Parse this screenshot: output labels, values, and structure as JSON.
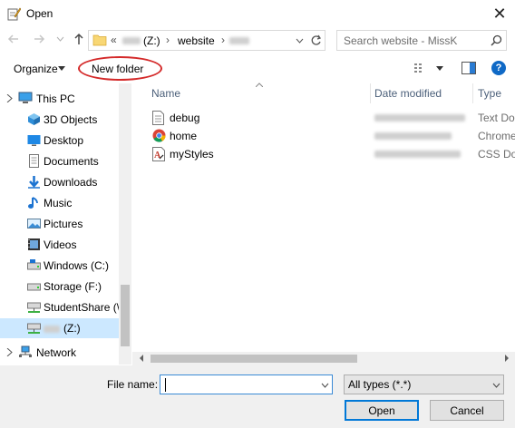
{
  "window": {
    "title": "Open",
    "close_glyph": "✕"
  },
  "nav": {
    "back_icon": "left-arrow-icon",
    "forward_icon": "right-arrow-icon",
    "up_icon": "up-arrow-icon",
    "address_prefix": "«",
    "drive_label": "(Z:)",
    "separator": "›",
    "current_folder": "website",
    "after_folder": "›",
    "search_placeholder": "Search website - MissK"
  },
  "toolbar": {
    "organize_label": "Organize",
    "new_folder_label": "New folder",
    "help_glyph": "?"
  },
  "sidebar": {
    "items": [
      {
        "label": "This PC",
        "icon": "pc-icon"
      },
      {
        "label": "3D Objects",
        "icon": "cube-icon"
      },
      {
        "label": "Desktop",
        "icon": "desktop-icon"
      },
      {
        "label": "Documents",
        "icon": "documents-icon"
      },
      {
        "label": "Downloads",
        "icon": "download-icon"
      },
      {
        "label": "Music",
        "icon": "music-icon"
      },
      {
        "label": "Pictures",
        "icon": "pictures-icon"
      },
      {
        "label": "Videos",
        "icon": "videos-icon"
      },
      {
        "label": "Windows (C:)",
        "icon": "drive-icon"
      },
      {
        "label": "Storage (F:)",
        "icon": "drive-icon"
      },
      {
        "label": "StudentShare (\\\\",
        "icon": "network-drive-icon"
      },
      {
        "label": "(Z:)",
        "icon": "network-drive-icon"
      },
      {
        "label": "Network",
        "icon": "network-icon"
      }
    ]
  },
  "columns": {
    "name": "Name",
    "date": "Date modified",
    "type": "Type"
  },
  "files": [
    {
      "name": "debug",
      "type": "Text Doc",
      "icon": "text-file-icon"
    },
    {
      "name": "home",
      "type": "Chrome",
      "icon": "chrome-icon"
    },
    {
      "name": "myStyles",
      "type": "CSS Doc",
      "icon": "css-file-icon"
    }
  ],
  "bottom": {
    "filename_label": "File name:",
    "filename_value": "",
    "filetype_value": "All types (*.*)",
    "open_label": "Open",
    "cancel_label": "Cancel"
  },
  "colors": {
    "accent": "#0078d7",
    "highlight_circle": "#d42a2a",
    "selected_bg": "#cce8ff"
  }
}
